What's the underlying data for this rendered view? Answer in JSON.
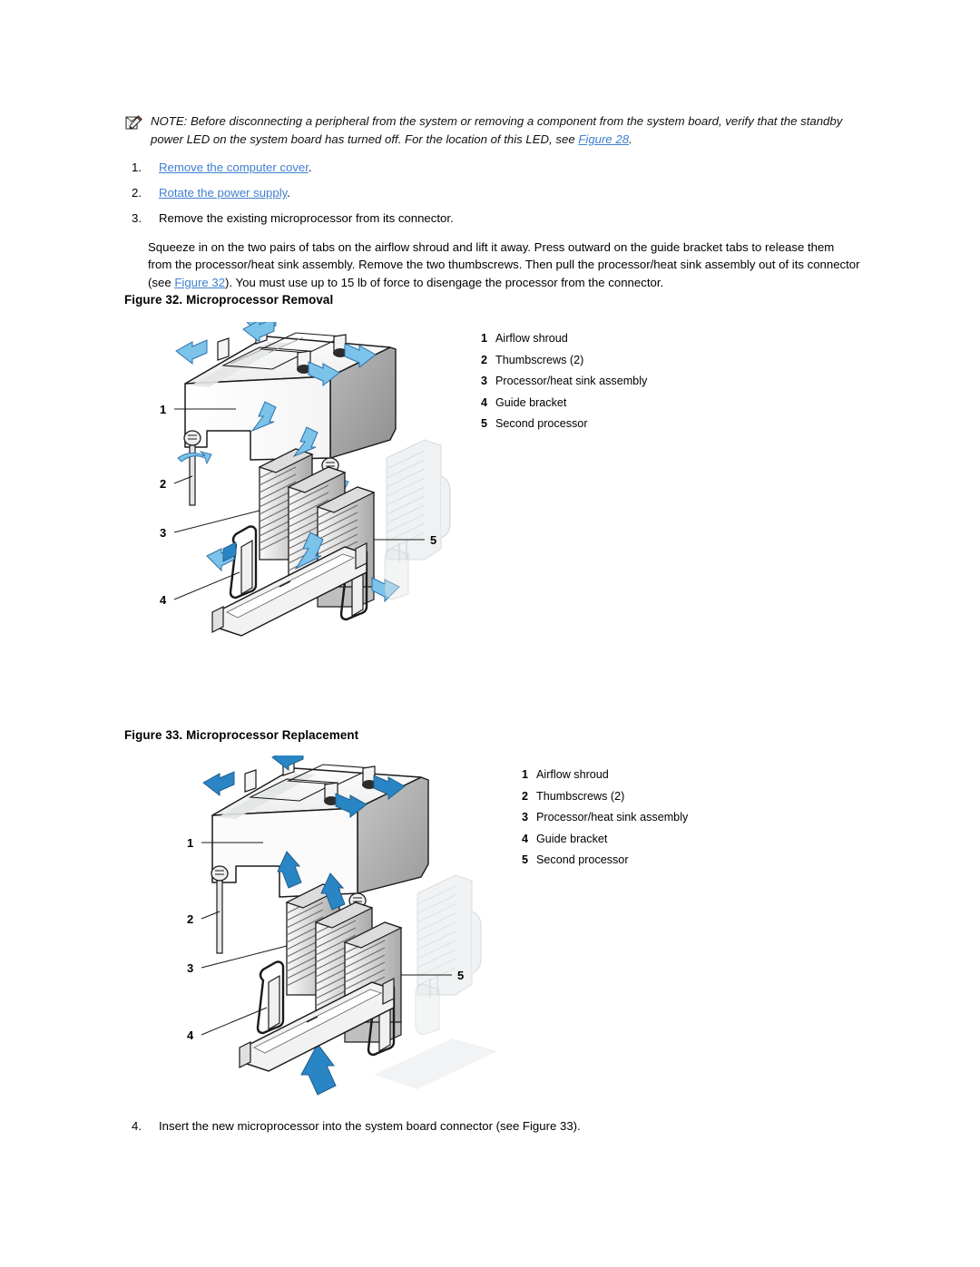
{
  "note": {
    "icon": "note-pencil-icon",
    "label": "NOTE:",
    "text_before_link": "NOTE: Before disconnecting a peripheral from the system or removing a component from the system board, verify that the standby power LED on the system board has turned off. For the location of this LED, see ",
    "link": "Figure 28",
    "text_after_link": "."
  },
  "steps": [
    {
      "num": "1.",
      "link": "Remove the computer cover",
      "is_link": true,
      "tail": "."
    },
    {
      "num": "2.",
      "link": "Rotate the power supply",
      "is_link": true,
      "tail": "."
    },
    {
      "num": "3.",
      "text": "Remove the existing microprocessor from its connector.",
      "is_link": false
    }
  ],
  "paragraph": {
    "part1": "Squeeze in on the two pairs of tabs on the airflow shroud and lift it away. Press outward on the guide bracket tabs to release them from the processor/heat sink assembly. Remove the two thumbscrews. Then pull the processor/heat sink assembly out of its connector (see ",
    "link": "Figure 32",
    "part2": "). You must use up to 15 lb of force to disengage the processor from the connector."
  },
  "figures": [
    {
      "caption": "Figure 32. Microprocessor Removal",
      "direction": "removal",
      "legend": [
        {
          "key": "1",
          "value": "Airflow shroud"
        },
        {
          "key": "2",
          "value": "Thumbscrews (2)"
        },
        {
          "key": "3",
          "value": "Processor/heat sink assembly"
        },
        {
          "key": "4",
          "value": "Guide bracket"
        },
        {
          "key": "5",
          "value": "Second processor"
        }
      ],
      "callouts": [
        "1",
        "2",
        "3",
        "4",
        "5"
      ]
    },
    {
      "caption": "Figure 33. Microprocessor Replacement",
      "direction": "replacement",
      "legend": [
        {
          "key": "1",
          "value": "Airflow shroud"
        },
        {
          "key": "2",
          "value": "Thumbscrews (2)"
        },
        {
          "key": "3",
          "value": "Processor/heat sink assembly"
        },
        {
          "key": "4",
          "value": "Guide bracket"
        },
        {
          "key": "5",
          "value": "Second processor"
        }
      ],
      "callouts": [
        "1",
        "2",
        "3",
        "4",
        "5"
      ]
    }
  ],
  "final_step": {
    "num": "4.",
    "text": "Insert the new microprocessor into the system board connector (see Figure 33)."
  },
  "colors": {
    "link": "#3f7fd0",
    "arrow_fill": "#7cc3ea",
    "arrow_stroke": "#2a6fa8",
    "arrow_dark": "#1f7ec0",
    "line_art": "#1a1a1a",
    "metal_light": "#e8e8e8",
    "metal_mid": "#c9c9c9",
    "metal_dark": "#9a9a9a",
    "ghost": "#d8dce0"
  }
}
